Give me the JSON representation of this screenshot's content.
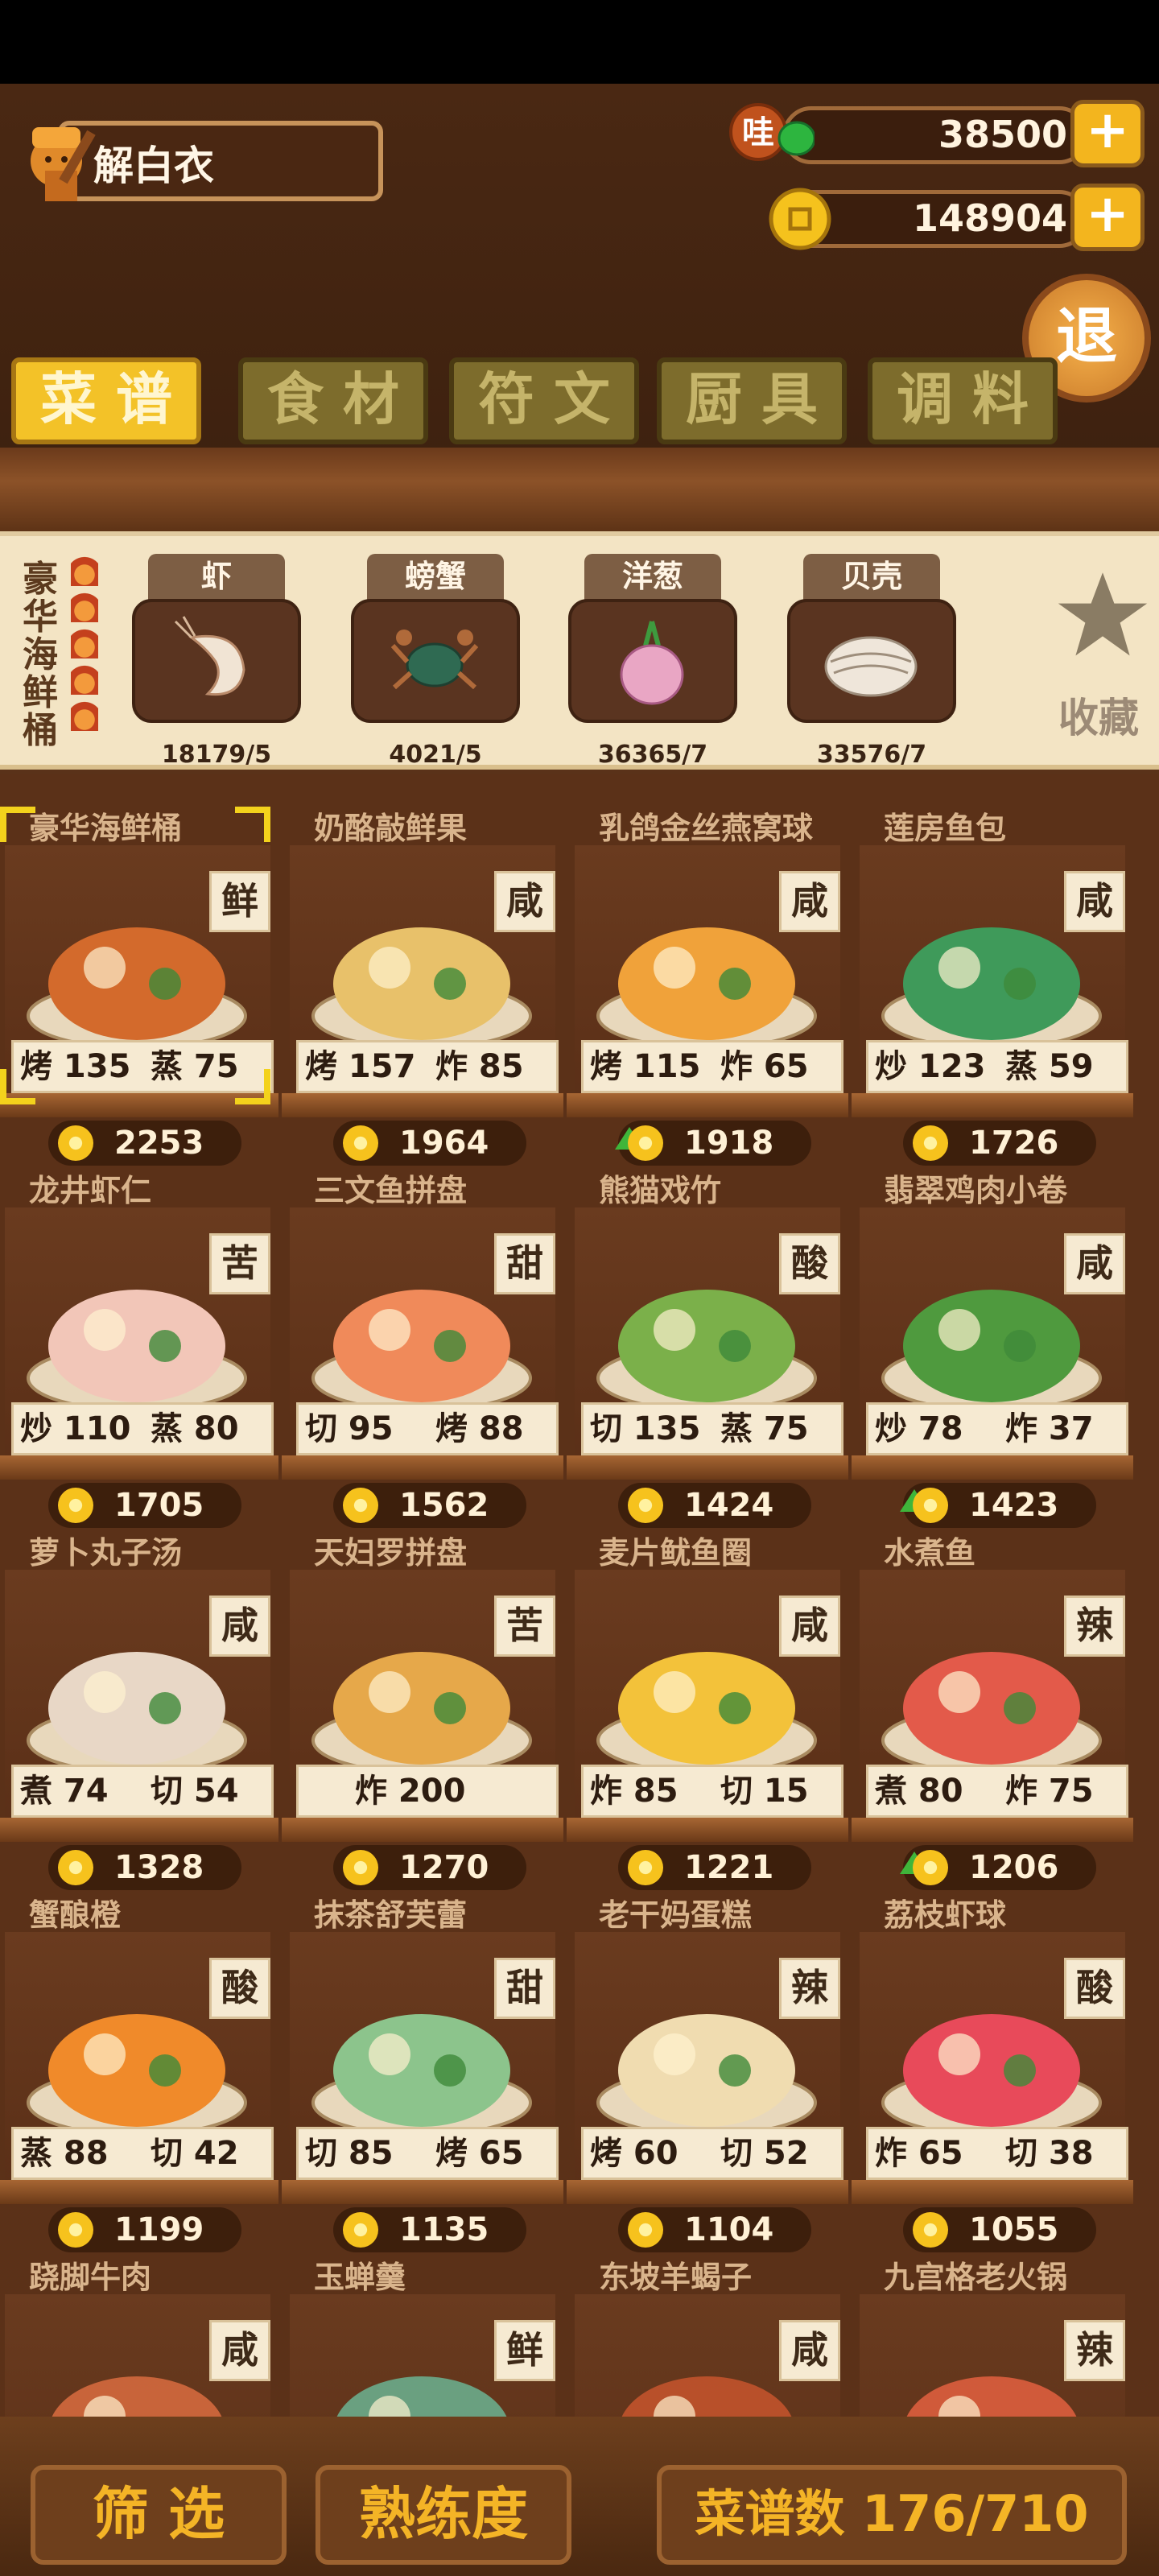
{
  "player": {
    "name": "解白衣"
  },
  "currency": {
    "jade": {
      "icon": "jade-coin-icon",
      "value": "38500"
    },
    "gold": {
      "icon": "gold-coin-icon",
      "value": "148904"
    },
    "plus": "+"
  },
  "exit_label": "退",
  "tabs": [
    "菜谱",
    "食材",
    "符文",
    "厨具",
    "调料"
  ],
  "selected_dish": {
    "name": "豪华海鲜桶",
    "ingredients": [
      {
        "name": "虾",
        "count": "18179/5",
        "icon": "shrimp-icon"
      },
      {
        "name": "螃蟹",
        "count": "4021/5",
        "icon": "crab-icon"
      },
      {
        "name": "洋葱",
        "count": "36365/7",
        "icon": "onion-icon"
      },
      {
        "name": "贝壳",
        "count": "33576/7",
        "icon": "shell-icon"
      }
    ],
    "favorite_label": "收藏"
  },
  "recipes": [
    {
      "name": "豪华海鲜桶",
      "flavor": "鲜",
      "skills": [
        [
          "烤",
          "135"
        ],
        [
          "蒸",
          "75"
        ]
      ],
      "price": "2253",
      "up": false,
      "selected": true
    },
    {
      "name": "奶酪敲鲜果",
      "flavor": "咸",
      "skills": [
        [
          "烤",
          "157"
        ],
        [
          "炸",
          "85"
        ]
      ],
      "price": "1964",
      "up": false
    },
    {
      "name": "乳鸽金丝燕窝球",
      "flavor": "咸",
      "skills": [
        [
          "烤",
          "115"
        ],
        [
          "炸",
          "65"
        ]
      ],
      "price": "1918",
      "up": true
    },
    {
      "name": "莲房鱼包",
      "flavor": "咸",
      "skills": [
        [
          "炒",
          "123"
        ],
        [
          "蒸",
          "59"
        ]
      ],
      "price": "1726",
      "up": false
    },
    {
      "name": "龙井虾仁",
      "flavor": "苦",
      "skills": [
        [
          "炒",
          "110"
        ],
        [
          "蒸",
          "80"
        ]
      ],
      "price": "1705",
      "up": false
    },
    {
      "name": "三文鱼拼盘",
      "flavor": "甜",
      "skills": [
        [
          "切",
          "95"
        ],
        [
          "烤",
          "88"
        ]
      ],
      "price": "1562",
      "up": false
    },
    {
      "name": "熊猫戏竹",
      "flavor": "酸",
      "skills": [
        [
          "切",
          "135"
        ],
        [
          "蒸",
          "75"
        ]
      ],
      "price": "1424",
      "up": false
    },
    {
      "name": "翡翠鸡肉小卷",
      "flavor": "咸",
      "skills": [
        [
          "炒",
          "78"
        ],
        [
          "炸",
          "37"
        ]
      ],
      "price": "1423",
      "up": true
    },
    {
      "name": "萝卜丸子汤",
      "flavor": "咸",
      "skills": [
        [
          "煮",
          "74"
        ],
        [
          "切",
          "54"
        ]
      ],
      "price": "1328",
      "up": false
    },
    {
      "name": "天妇罗拼盘",
      "flavor": "苦",
      "skills": [
        [
          "炸",
          "200"
        ]
      ],
      "price": "1270",
      "up": false
    },
    {
      "name": "麦片鱿鱼圈",
      "flavor": "咸",
      "skills": [
        [
          "炸",
          "85"
        ],
        [
          "切",
          "15"
        ]
      ],
      "price": "1221",
      "up": false
    },
    {
      "name": "水煮鱼",
      "flavor": "辣",
      "skills": [
        [
          "煮",
          "80"
        ],
        [
          "炸",
          "75"
        ]
      ],
      "price": "1206",
      "up": true
    },
    {
      "name": "蟹酿橙",
      "flavor": "酸",
      "skills": [
        [
          "蒸",
          "88"
        ],
        [
          "切",
          "42"
        ]
      ],
      "price": "1199",
      "up": false
    },
    {
      "name": "抹茶舒芙蕾",
      "flavor": "甜",
      "skills": [
        [
          "切",
          "85"
        ],
        [
          "烤",
          "65"
        ]
      ],
      "price": "1135",
      "up": false
    },
    {
      "name": "老干妈蛋糕",
      "flavor": "辣",
      "skills": [
        [
          "烤",
          "60"
        ],
        [
          "切",
          "52"
        ]
      ],
      "price": "1104",
      "up": false
    },
    {
      "name": "荔枝虾球",
      "flavor": "酸",
      "skills": [
        [
          "炸",
          "65"
        ],
        [
          "切",
          "38"
        ]
      ],
      "price": "1055",
      "up": false
    },
    {
      "name": "跷脚牛肉",
      "flavor": "咸",
      "skills": [],
      "price": "",
      "up": false
    },
    {
      "name": "玉蝉羹",
      "flavor": "鲜",
      "skills": [],
      "price": "",
      "up": false
    },
    {
      "name": "东坡羊蝎子",
      "flavor": "咸",
      "skills": [],
      "price": "",
      "up": false
    },
    {
      "name": "九宫格老火锅",
      "flavor": "辣",
      "skills": [],
      "price": "",
      "up": false
    }
  ],
  "bottom": {
    "filter_label": "筛 选",
    "mastery_label": "熟练度",
    "recipe_count": "菜谱数 176/710"
  }
}
